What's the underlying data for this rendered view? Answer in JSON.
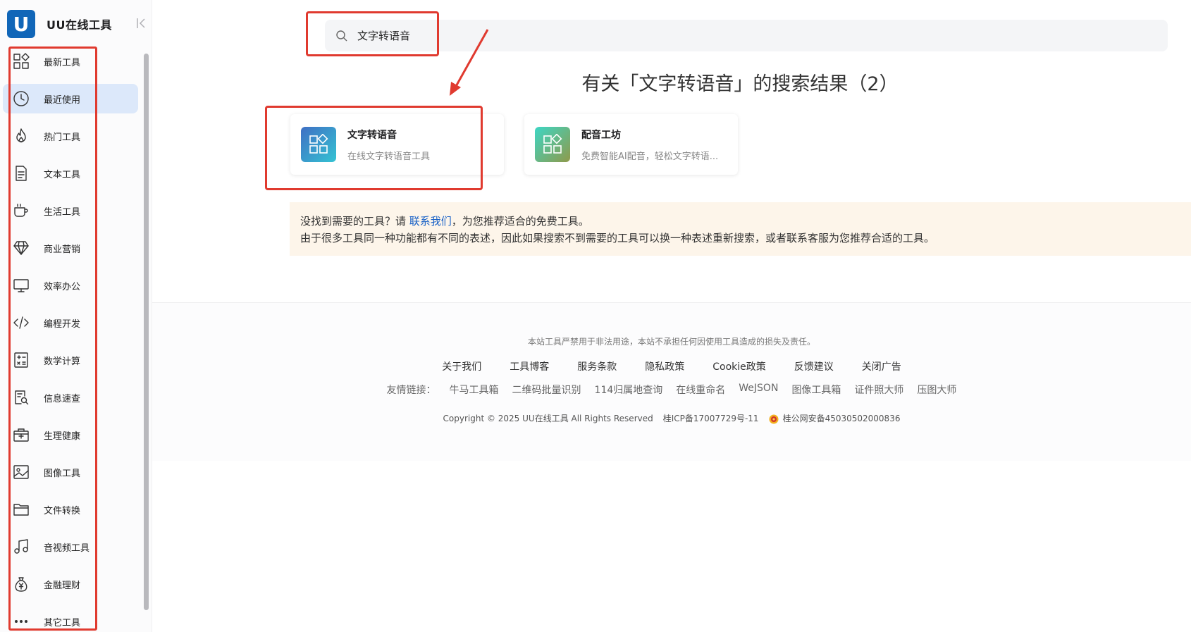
{
  "brand": {
    "logo_letter": "U",
    "name": "UU在线工具"
  },
  "sidebar": {
    "items": [
      {
        "label": "最新工具",
        "icon": "grid-new-icon",
        "active": false
      },
      {
        "label": "最近使用",
        "icon": "clock-icon",
        "active": true
      },
      {
        "label": "热门工具",
        "icon": "flame-icon",
        "active": false
      },
      {
        "label": "文本工具",
        "icon": "document-icon",
        "active": false
      },
      {
        "label": "生活工具",
        "icon": "cup-icon",
        "active": false
      },
      {
        "label": "商业营销",
        "icon": "diamond-icon",
        "active": false
      },
      {
        "label": "效率办公",
        "icon": "monitor-icon",
        "active": false
      },
      {
        "label": "编程开发",
        "icon": "code-icon",
        "active": false
      },
      {
        "label": "数学计算",
        "icon": "calculator-icon",
        "active": false
      },
      {
        "label": "信息速查",
        "icon": "search-doc-icon",
        "active": false
      },
      {
        "label": "生理健康",
        "icon": "medkit-icon",
        "active": false
      },
      {
        "label": "图像工具",
        "icon": "image-icon",
        "active": false
      },
      {
        "label": "文件转换",
        "icon": "folder-icon",
        "active": false
      },
      {
        "label": "音视频工具",
        "icon": "music-icon",
        "active": false
      },
      {
        "label": "金融理财",
        "icon": "money-bag-icon",
        "active": false
      },
      {
        "label": "其它工具",
        "icon": "more-icon",
        "active": false
      }
    ]
  },
  "search": {
    "value": "文字转语音",
    "placeholder": ""
  },
  "results": {
    "title": "有关「文字转语音」的搜索结果（2）",
    "cards": [
      {
        "title": "文字转语音",
        "desc": "在线文字转语音工具",
        "gradient": [
          "#3f6fc4",
          "#35c3d3"
        ]
      },
      {
        "title": "配音工坊",
        "desc": "免费智能AI配音，轻松文字转语...",
        "gradient": [
          "#3dd6c4",
          "#8f9a4a"
        ]
      }
    ]
  },
  "notice": {
    "line1_prefix": "没找到需要的工具？请 ",
    "contact_link": "联系我们",
    "line1_suffix": "，为您推荐适合的免费工具。",
    "line2": "由于很多工具同一种功能都有不同的表述，因此如果搜索不到需要的工具可以换一种表述重新搜索，或者联系客服为您推荐合适的工具。"
  },
  "footer": {
    "disclaimer": "本站工具严禁用于非法用途，本站不承担任何因使用工具造成的损失及责任。",
    "links": [
      "关于我们",
      "工具博客",
      "服务条款",
      "隐私政策",
      "Cookie政策",
      "反馈建议",
      "关闭广告"
    ],
    "friends_label": "友情链接：",
    "friends": [
      "牛马工具箱",
      "二维码批量识别",
      "114归属地查询",
      "在线重命名",
      "WeJSON",
      "图像工具箱",
      "证件照大师",
      "压图大师"
    ],
    "copyright": "Copyright © 2025 UU在线工具 All Rights Reserved",
    "icp": "桂ICP备17007729号-11",
    "police": "桂公网安备45030502000836"
  },
  "colors": {
    "accent": "#1166b8",
    "annotation_red": "#e03a2f",
    "active_bg": "#dce8fa",
    "notice_bg": "#fdf5ea",
    "link": "#1a62c7"
  }
}
